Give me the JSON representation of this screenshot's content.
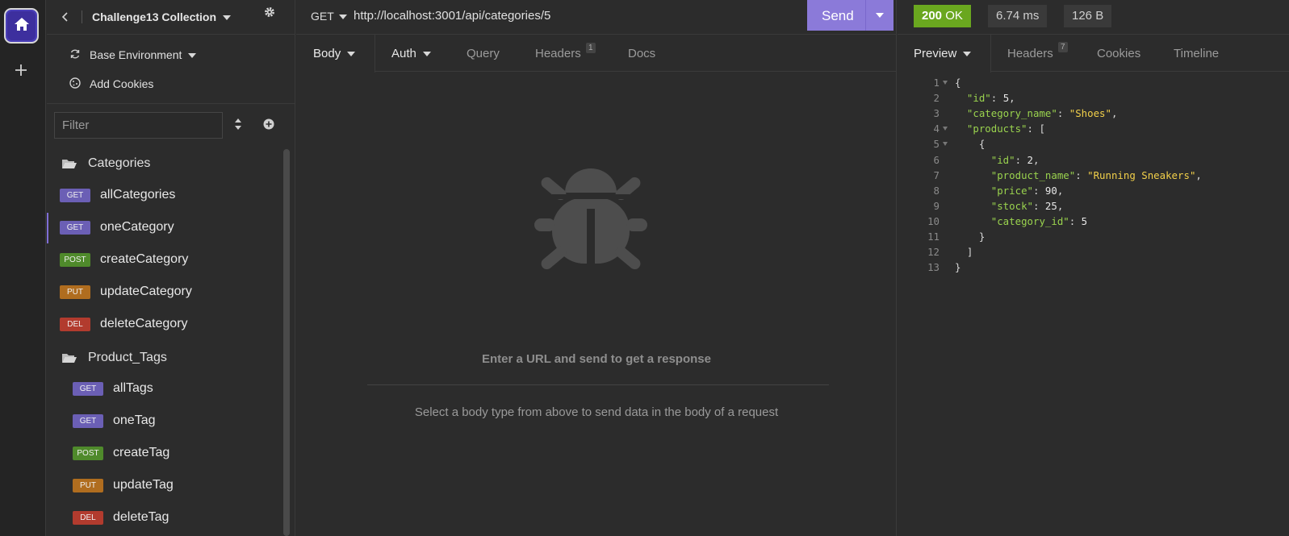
{
  "sidebar": {
    "collection_title": "Challenge13 Collection",
    "environment": "Base Environment",
    "add_cookies": "Add Cookies",
    "filter_placeholder": "Filter",
    "folders": [
      {
        "name": "Categories",
        "requests": [
          {
            "method": "GET",
            "name": "allCategories"
          },
          {
            "method": "GET",
            "name": "oneCategory"
          },
          {
            "method": "POST",
            "name": "createCategory"
          },
          {
            "method": "PUT",
            "name": "updateCategory"
          },
          {
            "method": "DEL",
            "name": "deleteCategory"
          }
        ]
      },
      {
        "name": "Product_Tags",
        "requests": [
          {
            "method": "GET",
            "name": "allTags"
          },
          {
            "method": "GET",
            "name": "oneTag"
          },
          {
            "method": "POST",
            "name": "createTag"
          },
          {
            "method": "PUT",
            "name": "updateTag"
          },
          {
            "method": "DEL",
            "name": "deleteTag"
          }
        ]
      }
    ]
  },
  "request": {
    "method": "GET",
    "url": "http://localhost:3001/api/categories/5",
    "send_label": "Send",
    "tabs": {
      "body": "Body",
      "auth": "Auth",
      "query": "Query",
      "headers": "Headers",
      "headers_count": "1",
      "docs": "Docs"
    },
    "empty_title": "Enter a URL and send to get a response",
    "empty_hint": "Select a body type from above to send data in the body of a request"
  },
  "response": {
    "status_code": "200",
    "status_text": "OK",
    "time": "6.74 ms",
    "size": "126 B",
    "tabs": {
      "preview": "Preview",
      "headers": "Headers",
      "headers_count": "7",
      "cookies": "Cookies",
      "timeline": "Timeline"
    },
    "body_lines": [
      "{",
      "  \"id\": 5,",
      "  \"category_name\": \"Shoes\",",
      "  \"products\": [",
      "    {",
      "      \"id\": 2,",
      "      \"product_name\": \"Running Sneakers\",",
      "      \"price\": 90,",
      "      \"stock\": 25,",
      "      \"category_id\": 5",
      "    }",
      "  ]",
      "}"
    ]
  },
  "colors": {
    "accent": "#8b7ad9",
    "status_ok": "#6aa71f",
    "GET": "#6b5fb5",
    "POST": "#4f8a2b",
    "PUT": "#b06d1f",
    "DEL": "#b23b2e",
    "json_key": "#9ad34e",
    "json_string": "#f2d04a"
  }
}
